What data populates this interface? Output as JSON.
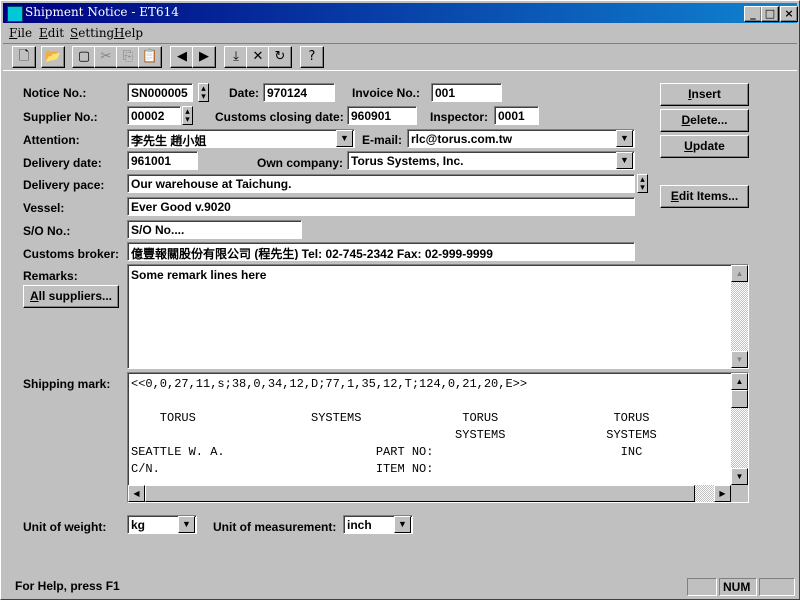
{
  "window": {
    "title": "Shipment Notice - ET614",
    "min_glyph": "_",
    "max_glyph": "□",
    "close_glyph": "×"
  },
  "menu": {
    "items": [
      {
        "label": "File",
        "accel": "F",
        "rest": "ile"
      },
      {
        "label": "Edit",
        "accel": "E",
        "rest": "dit"
      },
      {
        "label": "Setting",
        "accel": "S",
        "rest": "etting"
      },
      {
        "label": "Help",
        "accel": "H",
        "rest": "elp"
      }
    ]
  },
  "toolbar": {
    "icons": [
      "new-icon",
      "open-icon",
      "copy-doc-icon",
      "cut-icon",
      "paste-icon",
      "clipboard-icon",
      "prev-icon",
      "next-icon",
      "import-icon",
      "delete-x-icon",
      "refresh-icon",
      "help-icon"
    ],
    "glyphs": [
      "🗋",
      "📂",
      "▢",
      "✂",
      "⎘",
      "📋",
      "◀",
      "▶",
      "⤓",
      "✕",
      "↻",
      "?"
    ]
  },
  "form": {
    "notice_no": {
      "label": "Notice No.:",
      "value": "SN000005"
    },
    "date": {
      "label": "Date:",
      "value": "970124"
    },
    "invoice_no": {
      "label": "Invoice No.:",
      "value": "001"
    },
    "supplier_no": {
      "label": "Supplier No.:",
      "value": "00002"
    },
    "customs_closing_date": {
      "label": "Customs closing date:",
      "value": "960901"
    },
    "inspector": {
      "label": "Inspector:",
      "value": "0001"
    },
    "attention": {
      "label": "Attention:",
      "value": "李先生 趙小姐"
    },
    "email": {
      "label": "E-mail:",
      "value": "rlc@torus.com.tw"
    },
    "delivery_date": {
      "label": "Delivery date:",
      "value": "961001"
    },
    "own_company": {
      "label": "Own company:",
      "value": "Torus Systems, Inc."
    },
    "delivery_pace": {
      "label": "Delivery pace:",
      "value": "Our warehouse at Taichung."
    },
    "vessel": {
      "label": "Vessel:",
      "value": "Ever Good v.9020"
    },
    "so_no": {
      "label": "S/O No.:",
      "value": "S/O No...."
    },
    "customs_broker": {
      "label": "Customs broker:",
      "value": "億豐報關股份有限公司 (程先生) Tel: 02-745-2342 Fax: 02-999-9999"
    },
    "remarks": {
      "label": "Remarks:",
      "value": "Some remark lines here"
    },
    "shipping_mark": {
      "label": "Shipping mark:",
      "lines": [
        "<<0,0,27,11,s;38,0,34,12,D;77,1,35,12,T;124,0,21,20,E>>",
        "",
        "    TORUS                SYSTEMS              TORUS                TORUS",
        "                                             SYSTEMS              SYSTEMS",
        "SEATTLE W. A.                     PART NO:                          INC",
        "C/N.                              ITEM NO:"
      ]
    },
    "unit_of_weight": {
      "label": "Unit of weight:",
      "value": "kg"
    },
    "unit_of_measurement": {
      "label": "Unit of measurement:",
      "value": "inch"
    }
  },
  "buttons": {
    "insert": {
      "label": "Insert",
      "accel": "I",
      "rest": "nsert"
    },
    "delete": {
      "label": "Delete...",
      "accel": "D",
      "rest": "elete..."
    },
    "update": {
      "label": "Update",
      "accel": "U",
      "rest": "pdate"
    },
    "edit_items": {
      "label": "Edit Items...",
      "accel": "E",
      "rest": "dit Items..."
    },
    "all_suppliers": {
      "label": "All suppliers...",
      "accel": "A",
      "rest": "ll suppliers..."
    }
  },
  "status": {
    "help_text": "For Help, press F1",
    "num": "NUM"
  }
}
